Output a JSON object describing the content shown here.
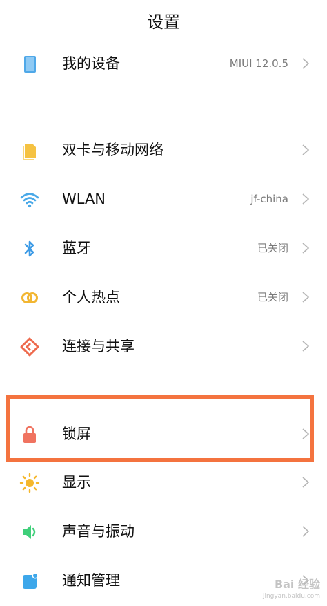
{
  "header": {
    "title": "设置"
  },
  "sections": {
    "device": {
      "items": [
        {
          "label": "我的设备",
          "value": "MIUI 12.0.5",
          "icon": "phone-device-icon"
        }
      ]
    },
    "network": {
      "items": [
        {
          "label": "双卡与移动网络",
          "value": "",
          "icon": "sim-card-icon"
        },
        {
          "label": "WLAN",
          "value": "jf-china",
          "icon": "wifi-icon"
        },
        {
          "label": "蓝牙",
          "value": "已关闭",
          "icon": "bluetooth-icon"
        },
        {
          "label": "个人热点",
          "value": "已关闭",
          "icon": "hotspot-icon"
        },
        {
          "label": "连接与共享",
          "value": "",
          "icon": "share-icon"
        }
      ]
    },
    "personal": {
      "items": [
        {
          "label": "锁屏",
          "value": "",
          "icon": "lock-icon"
        },
        {
          "label": "显示",
          "value": "",
          "icon": "sun-icon"
        },
        {
          "label": "声音与振动",
          "value": "",
          "icon": "speaker-icon"
        },
        {
          "label": "通知管理",
          "value": "",
          "icon": "notification-icon"
        }
      ]
    }
  },
  "colors": {
    "highlight": "#f4733f",
    "device_icon": "#4fa8e8",
    "sim_icon": "#f5c242",
    "wifi_icon": "#4aa9e8",
    "bluetooth_icon": "#3d9be6",
    "hotspot_icon": "#f2b632",
    "share_icon": "#ee6a4d",
    "lock_icon": "#f07360",
    "sun_icon": "#f5b72c",
    "speaker_icon": "#3fcf7a",
    "notification_icon": "#3da7ea"
  },
  "watermark": {
    "text": "Bai 经验",
    "sub": "jingyan.baidu.com"
  }
}
